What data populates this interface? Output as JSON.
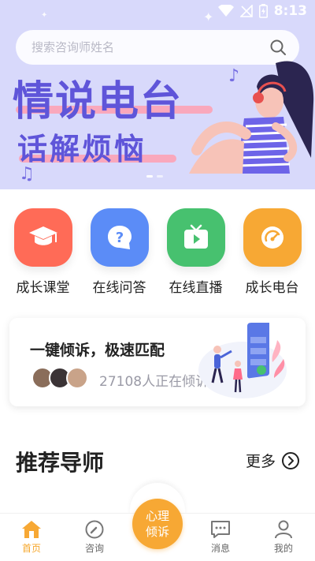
{
  "status": {
    "time": "8:13"
  },
  "search": {
    "placeholder": "搜索咨询师姓名"
  },
  "banner": {
    "title_line1": "情说电台",
    "title_line2": "话解烦恼",
    "slides": 2,
    "active_slide": 1
  },
  "categories": [
    {
      "label": "成长课堂",
      "icon": "graduation-cap-icon",
      "color": "#ff6b57"
    },
    {
      "label": "在线问答",
      "icon": "question-bubble-icon",
      "color": "#5b8cf7"
    },
    {
      "label": "在线直播",
      "icon": "tv-play-icon",
      "color": "#47c16f"
    },
    {
      "label": "成长电台",
      "icon": "radio-dial-icon",
      "color": "#f7a834"
    }
  ],
  "quick": {
    "title": "一键倾诉，极速匹配",
    "count_text": "27108人正在倾诉"
  },
  "section": {
    "title": "推荐导师",
    "more_label": "更多"
  },
  "fab": {
    "line1": "心理",
    "line2": "倾诉"
  },
  "tabs": [
    {
      "label": "首页",
      "icon": "home-icon",
      "active": true
    },
    {
      "label": "咨询",
      "icon": "compass-icon",
      "active": false
    },
    {
      "label": "消息",
      "icon": "message-icon",
      "active": false
    },
    {
      "label": "我的",
      "icon": "user-icon",
      "active": false
    }
  ],
  "colors": {
    "accent": "#f7a834",
    "banner_bg": "#d8d9fb",
    "banner_text": "#5f55d9"
  }
}
